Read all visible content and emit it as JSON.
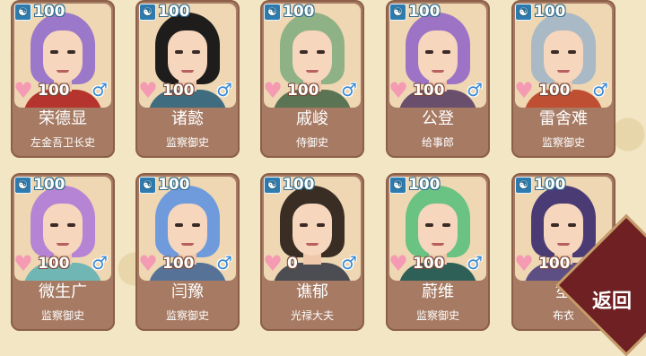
{
  "characters": [
    {
      "stat": "100",
      "favor": "100",
      "gender": "♂",
      "name": "荣德显",
      "title": "左金吾卫长史",
      "hair": "#9b78c9",
      "robe": "#b5352e"
    },
    {
      "stat": "100",
      "favor": "100",
      "gender": "♂",
      "name": "诸懿",
      "title": "监察御史",
      "hair": "#1f1d1c",
      "robe": "#3f6c7f"
    },
    {
      "stat": "100",
      "favor": "100",
      "gender": "♂",
      "name": "戚峻",
      "title": "侍御史",
      "hair": "#8fb186",
      "robe": "#5b7453"
    },
    {
      "stat": "100",
      "favor": "100",
      "gender": "♂",
      "name": "公登",
      "title": "给事郎",
      "hair": "#9d73c6",
      "robe": "#6a4f6d"
    },
    {
      "stat": "100",
      "favor": "100",
      "gender": "♂",
      "name": "雷舍难",
      "title": "监察御史",
      "hair": "#a9b9c6",
      "robe": "#bf4f33"
    },
    {
      "stat": "100",
      "favor": "100",
      "gender": "♂",
      "name": "微生广",
      "title": "监察御史",
      "hair": "#b684d4",
      "robe": "#6fb6b4"
    },
    {
      "stat": "100",
      "favor": "100",
      "gender": "♂",
      "name": "闫豫",
      "title": "监察御史",
      "hair": "#6f9bdc",
      "robe": "#567397"
    },
    {
      "stat": "100",
      "favor": "0",
      "gender": "♂",
      "name": "谯郁",
      "title": "光禄大夫",
      "hair": "#3a2e24",
      "robe": "#4b4d53"
    },
    {
      "stat": "100",
      "favor": "100",
      "gender": "♂",
      "name": "蔚维",
      "title": "监察御史",
      "hair": "#6ac283",
      "robe": "#2f6058"
    },
    {
      "stat": "100",
      "favor": "100",
      "gender": "♂",
      "name": "笙",
      "title": "布衣",
      "hair": "#4b3b75",
      "robe": "#5d4f84"
    }
  ],
  "back_button": {
    "label": "返回"
  },
  "icons": {
    "stat": "person-icon",
    "favor": "heart-icon",
    "gender": "male-icon"
  }
}
